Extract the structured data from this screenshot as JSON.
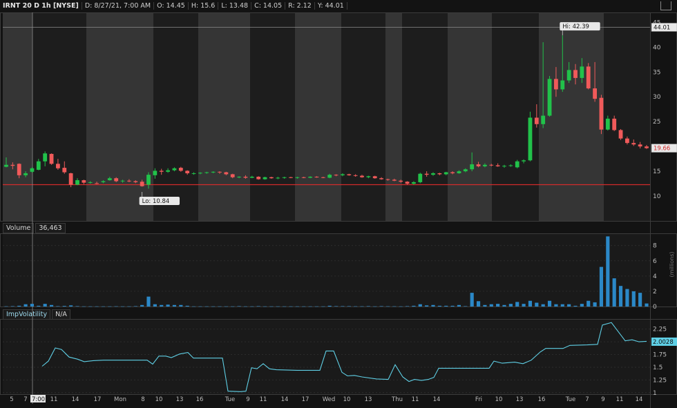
{
  "header": {
    "symbol": "IRNT 20 D 1h [NYSE]",
    "date": "D: 8/27/21, 7:00 AM",
    "open": "O: 14.45",
    "high": "H: 15.6",
    "low": "L: 13.48",
    "close": "C: 14.05",
    "range": "R: 2.12",
    "y": "Y: 44.01"
  },
  "colors": {
    "up": "#21c24a",
    "down": "#f05a5a",
    "volume": "#2b88c7",
    "iv_line": "#5fd0e6",
    "support_line": "#d42b2b",
    "crosshair": "#8c8c8c"
  },
  "price_badges": {
    "crosshair": "44.01",
    "last": "19.66",
    "hi_label": "Hi: 42.39",
    "lo_label": "Lo: 10.84"
  },
  "volume_pane": {
    "label": "Volume",
    "value": "36,463",
    "unit_label": "(millions)"
  },
  "iv_pane": {
    "label": "ImpVolatility",
    "value": "N/A",
    "last": "2.0028"
  },
  "x_axis": {
    "labels": [
      "5",
      "7",
      "7:00",
      "11",
      "14",
      "17",
      "Mon",
      "8",
      "10",
      "13",
      "16",
      "Tue",
      "9",
      "11",
      "14",
      "17",
      "Wed",
      "10",
      "13",
      "Thu",
      "11",
      "14",
      "Fri",
      "10",
      "13",
      "16",
      "Tue",
      "7",
      "9",
      "11",
      "14"
    ]
  },
  "chart_data": [
    {
      "type": "candlestick",
      "title": "IRNT 20 D 1h [NYSE]",
      "ylim": [
        5,
        47
      ],
      "y_ticks": [
        10,
        15,
        20,
        25,
        30,
        35,
        40,
        45
      ],
      "support_level": 12.3,
      "crosshair_level": 44.01,
      "candles": [
        [
          15.9,
          17.8,
          15.8,
          16.3
        ],
        [
          16.3,
          16.8,
          15.4,
          16.1
        ],
        [
          16.5,
          16.6,
          13.6,
          14.2
        ],
        [
          14.2,
          15.0,
          13.8,
          14.6
        ],
        [
          14.9,
          15.8,
          14.7,
          15.6
        ],
        [
          15.3,
          17.5,
          15.2,
          17.0
        ],
        [
          17.0,
          19.0,
          16.0,
          18.6
        ],
        [
          18.5,
          18.6,
          16.3,
          16.5
        ],
        [
          16.5,
          17.5,
          15.3,
          15.6
        ],
        [
          15.7,
          17.0,
          14.5,
          14.8
        ],
        [
          14.6,
          14.7,
          11.8,
          12.3
        ],
        [
          12.3,
          13.6,
          12.2,
          13.2
        ],
        [
          13.2,
          13.3,
          12.4,
          12.7
        ],
        [
          12.7,
          13.0,
          12.5,
          12.8
        ],
        [
          12.6,
          12.9,
          12.4,
          12.5
        ],
        [
          12.8,
          13.2,
          12.6,
          13.0
        ],
        [
          13.2,
          13.9,
          13.1,
          13.6
        ],
        [
          13.6,
          13.8,
          12.8,
          13.0
        ],
        [
          13.0,
          13.3,
          12.7,
          13.1
        ],
        [
          13.1,
          13.4,
          12.8,
          13.0
        ],
        [
          13.0,
          13.2,
          12.6,
          12.8
        ],
        [
          12.9,
          13.3,
          11.9,
          12.0
        ],
        [
          12.3,
          14.8,
          11.5,
          14.3
        ],
        [
          14.2,
          15.6,
          13.5,
          15.1
        ],
        [
          15.1,
          15.5,
          14.3,
          14.9
        ],
        [
          14.9,
          15.6,
          14.7,
          15.2
        ],
        [
          15.2,
          15.8,
          15.0,
          15.6
        ],
        [
          15.7,
          15.9,
          14.9,
          15.1
        ],
        [
          15.1,
          15.2,
          14.3,
          14.6
        ],
        [
          14.6,
          14.8,
          14.3,
          14.6
        ],
        [
          14.6,
          14.8,
          14.4,
          14.7
        ],
        [
          14.7,
          14.9,
          14.5,
          14.8
        ],
        [
          14.8,
          15.0,
          14.6,
          14.9
        ],
        [
          14.9,
          15.0,
          14.5,
          14.8
        ],
        [
          14.8,
          14.9,
          14.2,
          14.4
        ],
        [
          14.4,
          14.5,
          13.6,
          13.8
        ],
        [
          13.8,
          14.0,
          13.6,
          13.9
        ],
        [
          13.9,
          14.2,
          13.5,
          13.7
        ],
        [
          13.7,
          14.1,
          13.6,
          13.9
        ],
        [
          13.9,
          14.0,
          13.3,
          13.4
        ],
        [
          13.4,
          13.9,
          13.3,
          13.8
        ],
        [
          13.8,
          13.9,
          13.5,
          13.6
        ],
        [
          13.6,
          13.9,
          13.4,
          13.7
        ],
        [
          13.7,
          13.9,
          13.5,
          13.8
        ],
        [
          13.8,
          13.9,
          13.6,
          13.7
        ],
        [
          13.7,
          13.9,
          13.5,
          13.8
        ],
        [
          13.8,
          13.9,
          13.6,
          13.7
        ],
        [
          13.7,
          14.0,
          13.6,
          13.9
        ],
        [
          13.9,
          14.0,
          13.7,
          13.8
        ],
        [
          13.8,
          13.9,
          13.6,
          13.7
        ],
        [
          13.7,
          14.5,
          13.6,
          14.3
        ],
        [
          14.3,
          14.4,
          14.0,
          14.2
        ],
        [
          14.2,
          14.6,
          14.0,
          14.4
        ],
        [
          14.4,
          14.5,
          14.1,
          14.2
        ],
        [
          14.2,
          14.4,
          13.9,
          14.1
        ],
        [
          14.1,
          14.3,
          13.7,
          13.8
        ],
        [
          13.8,
          14.1,
          13.6,
          14.0
        ],
        [
          14.0,
          14.1,
          13.5,
          13.6
        ],
        [
          13.6,
          13.8,
          13.3,
          13.4
        ],
        [
          13.4,
          13.5,
          13.1,
          13.3
        ],
        [
          13.3,
          13.5,
          13.0,
          13.1
        ],
        [
          13.1,
          13.3,
          12.7,
          12.9
        ],
        [
          12.9,
          13.0,
          12.3,
          12.5
        ],
        [
          12.5,
          13.0,
          12.3,
          12.8
        ],
        [
          12.8,
          14.7,
          12.6,
          14.5
        ],
        [
          14.5,
          15.0,
          13.9,
          14.3
        ],
        [
          14.3,
          14.8,
          14.1,
          14.6
        ],
        [
          14.6,
          14.7,
          14.2,
          14.4
        ],
        [
          14.4,
          14.9,
          14.2,
          14.8
        ],
        [
          14.8,
          15.0,
          14.4,
          14.6
        ],
        [
          14.6,
          15.2,
          14.5,
          15.0
        ],
        [
          15.0,
          15.6,
          14.8,
          15.4
        ],
        [
          15.4,
          18.8,
          15.0,
          16.4
        ],
        [
          16.4,
          16.9,
          15.8,
          16.0
        ],
        [
          16.0,
          16.6,
          15.8,
          16.3
        ],
        [
          16.3,
          16.5,
          16.0,
          16.2
        ],
        [
          16.2,
          16.6,
          15.9,
          16.0
        ],
        [
          16.0,
          16.3,
          15.7,
          16.1
        ],
        [
          16.1,
          16.4,
          15.9,
          16.2
        ],
        [
          15.8,
          17.3,
          15.6,
          17.0
        ],
        [
          17.0,
          17.4,
          16.6,
          17.2
        ],
        [
          17.2,
          27.0,
          17.0,
          25.8
        ],
        [
          25.8,
          28.5,
          23.8,
          24.5
        ],
        [
          24.5,
          41.0,
          23.7,
          26.2
        ],
        [
          26.2,
          34.2,
          26.0,
          33.6
        ],
        [
          33.6,
          36.0,
          30.0,
          31.5
        ],
        [
          31.5,
          42.39,
          31.0,
          33.3
        ],
        [
          33.3,
          37.0,
          32.8,
          35.4
        ],
        [
          35.4,
          36.6,
          32.5,
          33.8
        ],
        [
          33.8,
          37.8,
          32.8,
          36.1
        ],
        [
          36.1,
          36.8,
          31.5,
          31.7
        ],
        [
          31.7,
          37.0,
          29.0,
          29.6
        ],
        [
          29.8,
          30.4,
          22.5,
          23.4
        ],
        [
          23.4,
          26.2,
          23.2,
          25.6
        ],
        [
          25.6,
          26.2,
          23.1,
          23.3
        ],
        [
          23.3,
          23.5,
          21.3,
          21.6
        ],
        [
          21.6,
          22.0,
          20.4,
          20.7
        ],
        [
          20.7,
          21.4,
          20.1,
          20.4
        ],
        [
          20.4,
          20.9,
          19.6,
          20.0
        ],
        [
          20.0,
          20.3,
          19.5,
          19.66
        ]
      ],
      "hi": 42.39,
      "lo": 10.84,
      "last": 19.66
    },
    {
      "type": "bar",
      "title": "Volume",
      "ylim": [
        0,
        9.6
      ],
      "y_ticks": [
        0,
        2,
        4,
        6,
        8
      ],
      "values": [
        0.03,
        0.05,
        0.1,
        0.3,
        0.35,
        0.1,
        0.35,
        0.2,
        0.05,
        0.08,
        0.15,
        0.05,
        0.02,
        0.02,
        0.02,
        0.02,
        0.02,
        0.03,
        0.02,
        0.02,
        0.05,
        0.2,
        1.3,
        0.3,
        0.2,
        0.25,
        0.2,
        0.2,
        0.1,
        0.02,
        0.02,
        0.02,
        0.02,
        0.02,
        0.02,
        0.02,
        0.05,
        0.02,
        0.02,
        0.05,
        0.02,
        0.02,
        0.02,
        0.02,
        0.02,
        0.02,
        0.02,
        0.02,
        0.02,
        0.02,
        0.1,
        0.05,
        0.05,
        0.05,
        0.03,
        0.03,
        0.05,
        0.02,
        0.05,
        0.03,
        0.03,
        0.02,
        0.05,
        0.1,
        0.3,
        0.15,
        0.2,
        0.1,
        0.1,
        0.1,
        0.2,
        0.05,
        1.8,
        0.7,
        0.2,
        0.3,
        0.35,
        0.2,
        0.35,
        0.6,
        0.35,
        0.75,
        0.5,
        0.3,
        0.75,
        0.3,
        0.3,
        0.3,
        0.1,
        0.35,
        0.75,
        0.55,
        5.2,
        9.2,
        3.7,
        2.7,
        2.3,
        2.0,
        1.8,
        0.4
      ]
    },
    {
      "type": "line",
      "title": "ImpVolatility",
      "ylim": [
        0.97,
        2.45
      ],
      "y_ticks": [
        1,
        1.25,
        1.5,
        1.75,
        2,
        2.25
      ],
      "points": [
        [
          61,
          1.52
        ],
        [
          70,
          1.62
        ],
        [
          80,
          1.88
        ],
        [
          89,
          1.85
        ],
        [
          100,
          1.7
        ],
        [
          112,
          1.66
        ],
        [
          122,
          1.61
        ],
        [
          135,
          1.63
        ],
        [
          150,
          1.64
        ],
        [
          170,
          1.64
        ],
        [
          190,
          1.64
        ],
        [
          213,
          1.64
        ],
        [
          221,
          1.56
        ],
        [
          230,
          1.72
        ],
        [
          240,
          1.72
        ],
        [
          248,
          1.69
        ],
        [
          260,
          1.76
        ],
        [
          272,
          1.79
        ],
        [
          280,
          1.68
        ],
        [
          322,
          1.68
        ],
        [
          330,
          1.03
        ],
        [
          348,
          1.02
        ],
        [
          356,
          1.03
        ],
        [
          364,
          1.49
        ],
        [
          372,
          1.47
        ],
        [
          381,
          1.57
        ],
        [
          390,
          1.47
        ],
        [
          400,
          1.45
        ],
        [
          430,
          1.44
        ],
        [
          463,
          1.44
        ],
        [
          472,
          1.82
        ],
        [
          483,
          1.82
        ],
        [
          495,
          1.4
        ],
        [
          503,
          1.33
        ],
        [
          513,
          1.34
        ],
        [
          524,
          1.31
        ],
        [
          545,
          1.27
        ],
        [
          562,
          1.26
        ],
        [
          572,
          1.55
        ],
        [
          583,
          1.31
        ],
        [
          592,
          1.22
        ],
        [
          600,
          1.26
        ],
        [
          610,
          1.24
        ],
        [
          620,
          1.26
        ],
        [
          628,
          1.3
        ],
        [
          635,
          1.48
        ],
        [
          655,
          1.48
        ],
        [
          700,
          1.48
        ],
        [
          708,
          1.48
        ],
        [
          715,
          1.62
        ],
        [
          727,
          1.58
        ],
        [
          745,
          1.6
        ],
        [
          757,
          1.57
        ],
        [
          769,
          1.64
        ],
        [
          782,
          1.8
        ],
        [
          790,
          1.87
        ],
        [
          815,
          1.87
        ],
        [
          825,
          1.93
        ],
        [
          850,
          1.94
        ],
        [
          865,
          1.95
        ],
        [
          872,
          2.33
        ],
        [
          885,
          2.38
        ],
        [
          905,
          2.02
        ],
        [
          915,
          2.04
        ],
        [
          925,
          2.0
        ],
        [
          936,
          2.01
        ]
      ]
    }
  ]
}
